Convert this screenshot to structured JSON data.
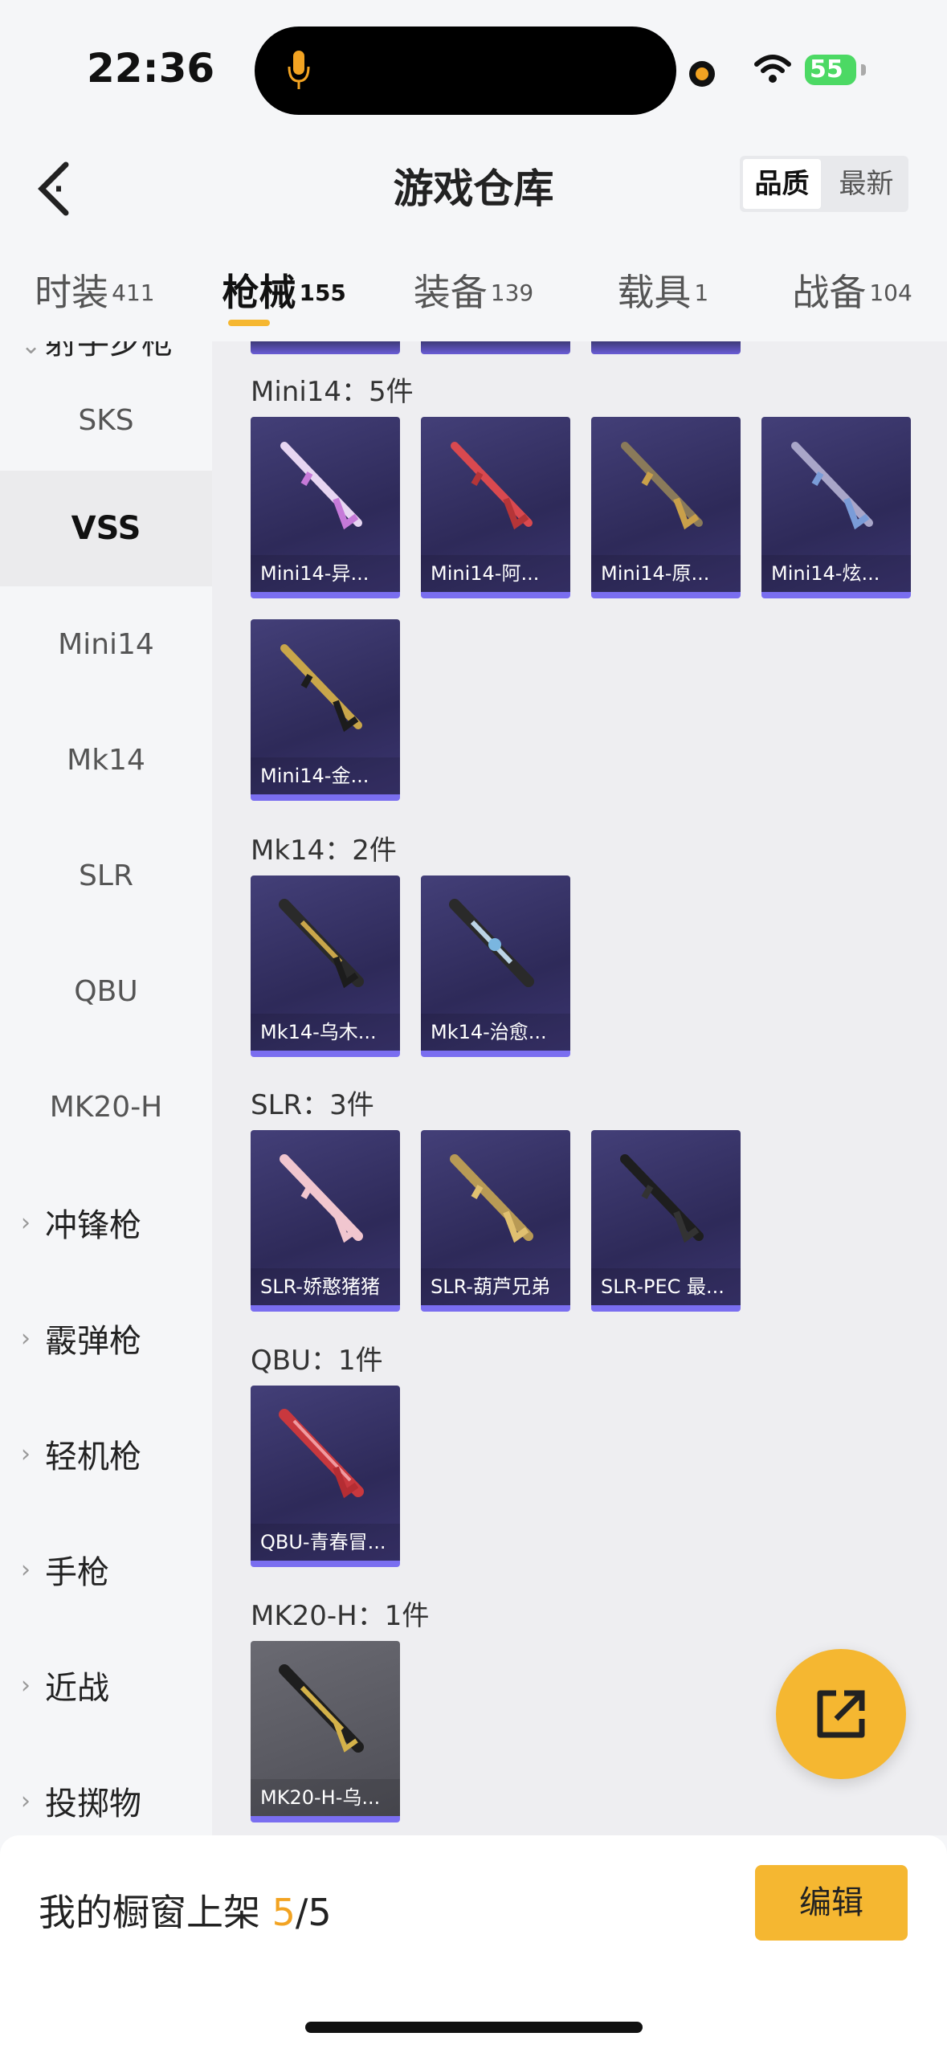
{
  "status_bar": {
    "time": "22:36",
    "battery": "55"
  },
  "header": {
    "title": "游戏仓库",
    "sort_options": [
      "品质",
      "最新"
    ],
    "sort_active": "品质"
  },
  "tabs": [
    {
      "label": "时装",
      "count": "411"
    },
    {
      "label": "枪械",
      "count": "155",
      "active": true
    },
    {
      "label": "装备",
      "count": "139"
    },
    {
      "label": "载具",
      "count": "1"
    },
    {
      "label": "战备",
      "count": "104"
    }
  ],
  "sidebar": {
    "partial_top": "射手步枪",
    "items": [
      "SKS",
      "VSS",
      "Mini14",
      "Mk14",
      "SLR",
      "QBU",
      "MK20-H"
    ],
    "active_item": "VSS",
    "groups": [
      "冲锋枪",
      "霰弹枪",
      "轻机枪",
      "手枪",
      "近战",
      "投掷物"
    ]
  },
  "sections": [
    {
      "title": "Mini14：5件",
      "items": [
        "Mini14-异...",
        "Mini14-阿...",
        "Mini14-原...",
        "Mini14-炫...",
        "Mini14-金..."
      ]
    },
    {
      "title": "Mk14：2件",
      "items": [
        "Mk14-乌木...",
        "Mk14-治愈..."
      ]
    },
    {
      "title": "SLR：3件",
      "items": [
        "SLR-娇憨猪猪",
        "SLR-葫芦兄弟",
        "SLR-PEC 最..."
      ]
    },
    {
      "title": "QBU：1件",
      "items": [
        "QBU-青春冒..."
      ]
    },
    {
      "title": "MK20-H：1件",
      "items": [
        "MK20-H-乌..."
      ]
    }
  ],
  "bottom_bar": {
    "label": "我的橱窗上架",
    "current": "5",
    "total": "/5",
    "edit_label": "编辑"
  },
  "colors": {
    "accent": "#f5b731",
    "card_bg": "#2e2a59",
    "card_stripe": "#7a6ef0"
  }
}
